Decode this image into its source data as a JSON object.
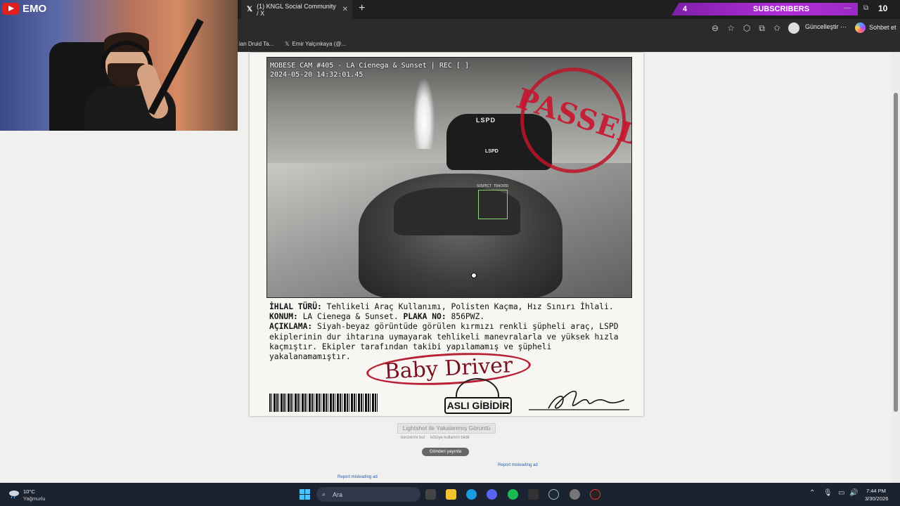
{
  "browser": {
    "tab_title": "(1) KNGL Social Community / X",
    "tab_close": "✕",
    "new_tab": "+",
    "update_label": "Güncelleştir ⋯",
    "chat_label": "Sohbet et",
    "bookmarks": [
      {
        "label": "ian Druid Ta..."
      },
      {
        "label": "Emir Yalçınkaya (@..."
      }
    ]
  },
  "overlay": {
    "streamer": "EMO",
    "subscriber_count": "4",
    "subscriber_label": "SUBSCRIBERS",
    "corner_value": "10"
  },
  "cam_photo": {
    "header": "MOBESE CAM #405 - LA Cienega & Sunset | REC [ ]",
    "timestamp": "2024-05-20 14:32:01.45",
    "stamp": "PASSED",
    "vehicle_label": "LSPD",
    "vehicle_label_rear": "LSPD",
    "tracker_label": "SUSPECT TRACKED"
  },
  "report": {
    "violation_label": "İHLAL TÜRÜ:",
    "violation_value": " Tehlikeli Araç Kullanımı, Polisten Kaçma, Hız Sınırı İhlali.",
    "location_label": "KONUM:",
    "location_value": " LA Cienega & Sunset. ",
    "plate_label": "PLAKA NO:",
    "plate_value": " 856PWZ.",
    "desc_label": "AÇIKLAMA:",
    "desc_value": " Siyah-beyaz görüntüde görülen kırmızı renkli şüpheli araç, LSPD ekiplerinin dur ihtarına uymayarak tehlikeli manevralarla ve yüksek hızla kaçmıştır. Ekipler tarafından takibi yapılamamış ve şüpheli yakalanamamıştır.",
    "nickname": "Baby Driver",
    "seal_text": "ASLI GİBİDİR"
  },
  "lightshot": {
    "caption": "Lightshot ile Yakalanmış Görüntü",
    "link_similar": "benzerini bul",
    "link_report": "kötüye kullanım bildir",
    "post_button": "Gönderi yayınla",
    "report_ad": "Report misleading ad",
    "report_ad_2": "Report misleading ad"
  },
  "taskbar": {
    "temperature": "10°C",
    "weather": "Yağmurlu",
    "search_placeholder": "Ara",
    "time": "7:44 PM",
    "date": "3/30/2026"
  },
  "colors": {
    "stamp_red": "#c8142d",
    "subs_purple": "#b12dd9",
    "taskbar": "#1b2230"
  }
}
